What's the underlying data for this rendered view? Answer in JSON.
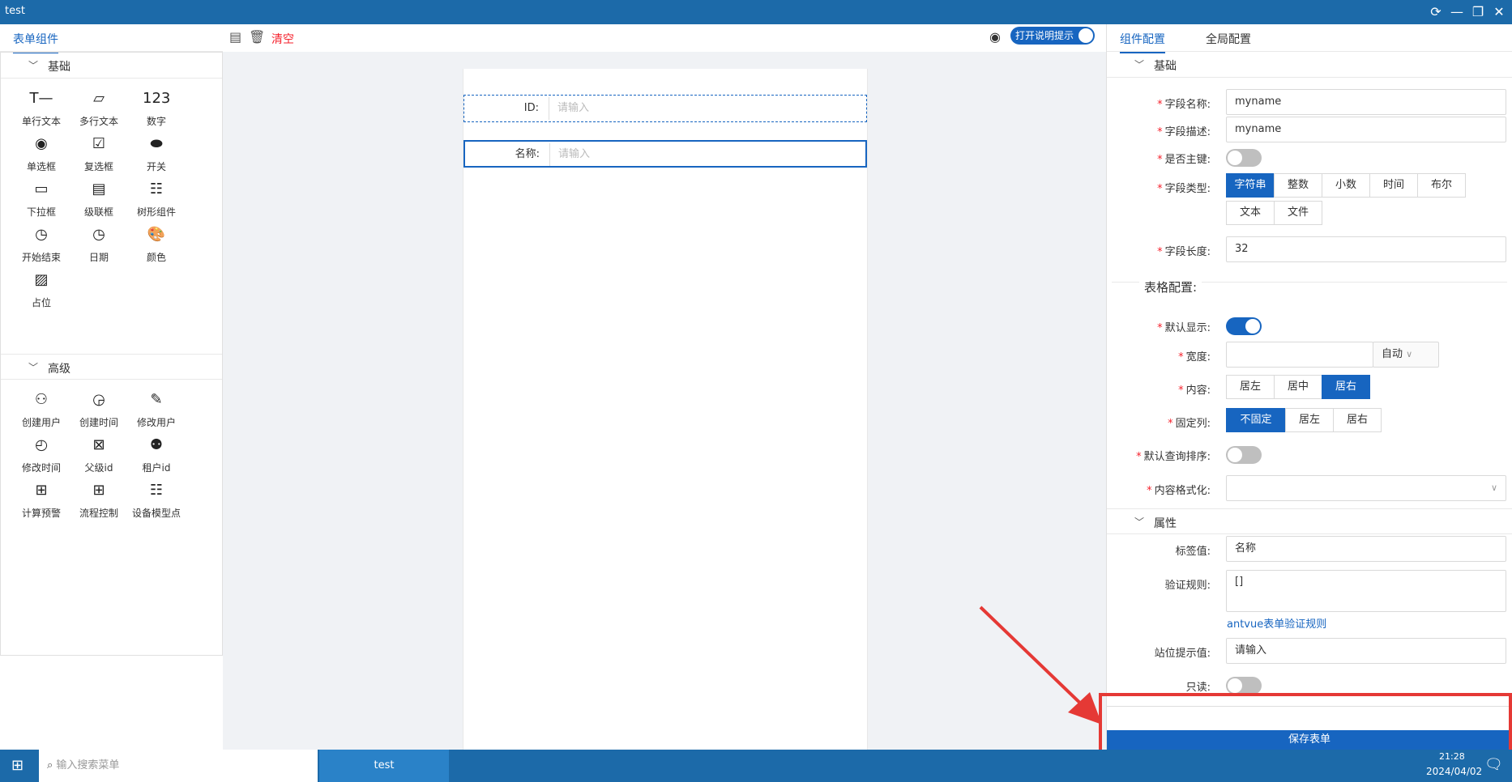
{
  "window": {
    "title": "test"
  },
  "left": {
    "tabs": [
      "表单组件"
    ],
    "sections": [
      {
        "title": "基础",
        "items": [
          "单行文本",
          "多行文本",
          "数字",
          "单选框",
          "复选框",
          "开关",
          "下拉框",
          "级联框",
          "树形组件",
          "开始结束",
          "日期",
          "颜色",
          "占位"
        ]
      },
      {
        "title": "高级",
        "items": [
          "创建用户",
          "创建时间",
          "修改用户",
          "修改时间",
          "父级id",
          "租户id",
          "计算预警",
          "流程控制",
          "设备模型点"
        ]
      }
    ],
    "icons": [
      "text-input-icon",
      "textarea-icon",
      "number-icon",
      "radio-icon",
      "checkbox-icon",
      "switch-icon",
      "select-icon",
      "cascader-icon",
      "tree-icon",
      "clock-icon",
      "clock-icon",
      "palette-icon",
      "placeholder-icon",
      "add-user-icon",
      "add-time-icon",
      "edit-user-icon",
      "edit-time-icon",
      "parent-id-icon",
      "tenant-id-icon",
      "calculator-icon",
      "calculator-icon",
      "tree-icon"
    ]
  },
  "toolbar": {
    "clear_label": "清空",
    "help_toggle_label": "打开说明提示"
  },
  "canvas": {
    "fields": [
      {
        "label": "ID:",
        "placeholder": "请输入"
      },
      {
        "label": "名称:",
        "placeholder": "请输入"
      }
    ]
  },
  "right": {
    "tabs": [
      "组件配置",
      "全局配置"
    ],
    "basic": {
      "title": "基础",
      "field_name_label": "字段名称:",
      "field_name": "myname",
      "field_desc_label": "字段描述:",
      "field_desc": "myname",
      "primary_key_label": "是否主键:",
      "field_type_label": "字段类型:",
      "field_types": [
        "字符串",
        "整数",
        "小数",
        "时间",
        "布尔",
        "文本",
        "文件"
      ],
      "field_length_label": "字段长度:",
      "field_length": "32"
    },
    "table": {
      "title": "表格配置:",
      "default_show_label": "默认显示:",
      "width_label": "宽度:",
      "width_unit": "自动",
      "content_label": "内容:",
      "content_opts": [
        "居左",
        "居中",
        "居右"
      ],
      "fixed_label": "固定列:",
      "fixed_opts": [
        "不固定",
        "居左",
        "居右"
      ],
      "sort_label": "默认查询排序:",
      "format_label": "内容格式化:"
    },
    "props": {
      "title": "属性",
      "tag_label": "标签值:",
      "tag_value": "名称",
      "rule_label": "验证规则:",
      "rule_value": "[]",
      "rule_link": "antvue表单验证规则",
      "placeholder_label": "站位提示值:",
      "placeholder_value": "请输入",
      "readonly_label": "只读:"
    },
    "save_label": "保存表单"
  },
  "taskbar": {
    "search_placeholder": "输入搜索菜单",
    "app": "test",
    "time": "21:28",
    "date": "2024/04/02"
  },
  "colors": {
    "accent": "#1765c0",
    "titlebar": "#1c6aa9",
    "danger": "#f5222d",
    "annotation": "#e53935"
  }
}
